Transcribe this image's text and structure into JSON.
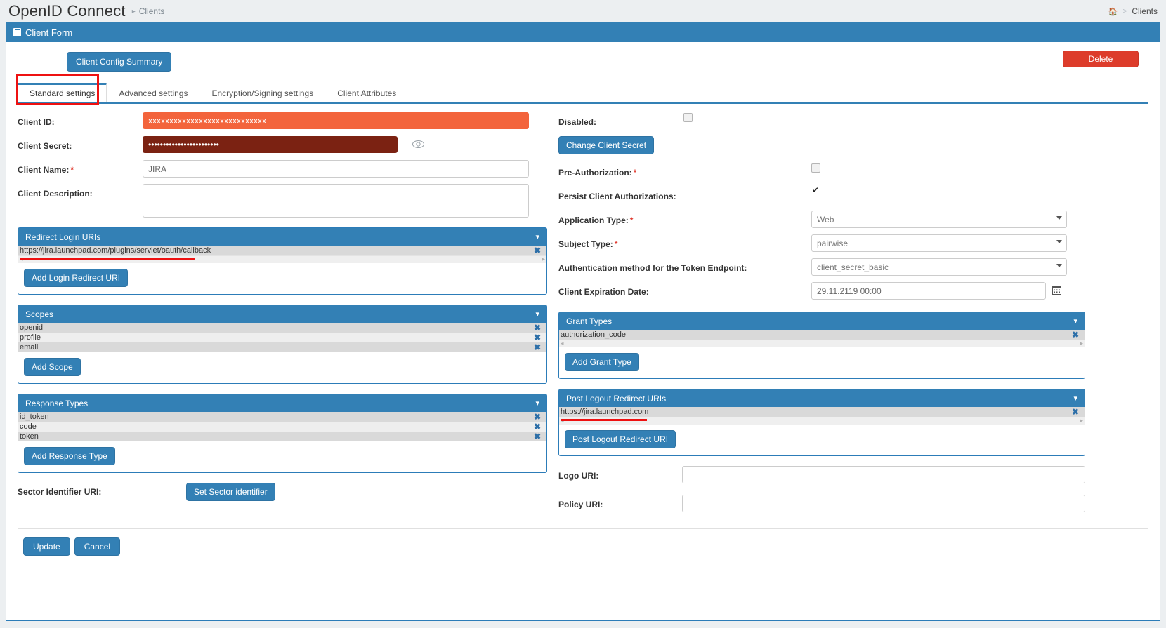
{
  "header": {
    "app_title": "OpenID Connect",
    "breadcrumb_sep": "▸",
    "breadcrumb_current": "Clients",
    "right_home_icon": "home-icon",
    "right_sep": ">",
    "right_label": "Clients"
  },
  "panel": {
    "title": "Client Form",
    "icon": "form-icon"
  },
  "toolbar": {
    "summary_label": "Client Config Summary",
    "delete_label": "Delete"
  },
  "tabs": [
    {
      "label": "Standard settings",
      "active": true
    },
    {
      "label": "Advanced settings",
      "active": false
    },
    {
      "label": "Encryption/Signing settings",
      "active": false
    },
    {
      "label": "Client Attributes",
      "active": false
    }
  ],
  "left": {
    "client_id": {
      "label": "Client ID:",
      "value": "xxxxxxxxxxxxxxxxxxxxxxxxxxxx"
    },
    "client_secret": {
      "label": "Client Secret:",
      "value": "••••••••••••••••••••••••",
      "toggle_icon": "eye-icon"
    },
    "client_name": {
      "label": "Client Name:",
      "required": "*",
      "value": "JIRA"
    },
    "client_description": {
      "label": "Client Description:",
      "value": ""
    },
    "redirect_login": {
      "title": "Redirect Login URIs",
      "chevron": "⌄",
      "items": [
        "https://jira.launchpad.com/plugins/servlet/oauth/callback"
      ],
      "remove_icon": "✖",
      "add_label": "Add Login Redirect URI"
    },
    "scopes": {
      "title": "Scopes",
      "chevron": "⌄",
      "items": [
        "openid",
        "profile",
        "email"
      ],
      "remove_icon": "✖",
      "add_label": "Add Scope"
    },
    "response_types": {
      "title": "Response Types",
      "chevron": "⌄",
      "items": [
        "id_token",
        "code",
        "token"
      ],
      "remove_icon": "✖",
      "add_label": "Add Response Type"
    },
    "sector_identifier": {
      "label": "Sector Identifier URI:",
      "button_label": "Set Sector identifier"
    }
  },
  "right": {
    "disabled": {
      "label": "Disabled:",
      "checked": false
    },
    "change_secret_label": "Change Client Secret",
    "pre_authorization": {
      "label": "Pre-Authorization:",
      "required": "*",
      "checked": false
    },
    "persist_client_auth": {
      "label": "Persist Client Authorizations:",
      "checked": true
    },
    "application_type": {
      "label": "Application Type:",
      "required": "*",
      "value": "Web"
    },
    "subject_type": {
      "label": "Subject Type:",
      "required": "*",
      "value": "pairwise"
    },
    "auth_method": {
      "label": "Authentication method for the Token Endpoint:",
      "value": "client_secret_basic"
    },
    "client_expiration": {
      "label": "Client Expiration Date:",
      "value": "29.11.2119 00:00",
      "calendar_icon": "calendar-icon"
    },
    "grant_types": {
      "title": "Grant Types",
      "chevron": "⌄",
      "items": [
        "authorization_code"
      ],
      "remove_icon": "✖",
      "add_label": "Add Grant Type"
    },
    "post_logout": {
      "title": "Post Logout Redirect URIs",
      "chevron": "⌄",
      "items": [
        "https://jira.launchpad.com"
      ],
      "remove_icon": "✖",
      "add_label": "Post Logout Redirect URI"
    },
    "logo_uri": {
      "label": "Logo URI:",
      "value": ""
    },
    "policy_uri": {
      "label": "Policy URI:",
      "value": ""
    }
  },
  "footer": {
    "update_label": "Update",
    "cancel_label": "Cancel"
  },
  "colors": {
    "accent": "#3380b5",
    "danger": "#dd3c2b",
    "client_id_bg": "#f3643c",
    "client_secret_bg": "#7b2212",
    "annotation_red": "#ee1111"
  }
}
